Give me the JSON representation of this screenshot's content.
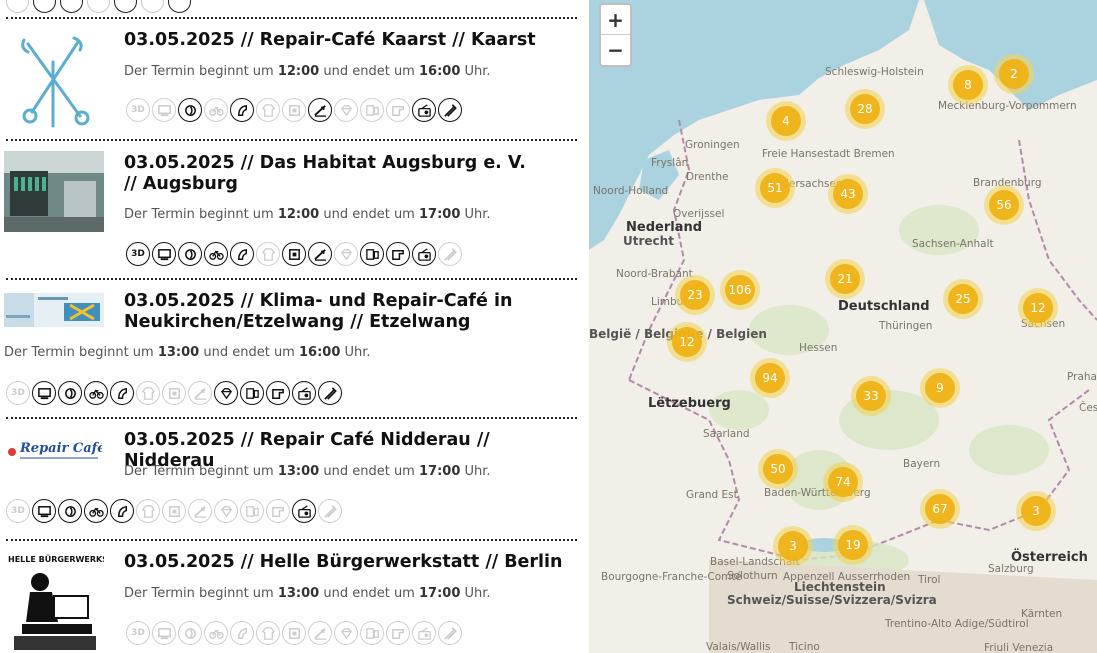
{
  "events": [
    {
      "title": "03.05.2025 // Repair-Café Kaarst // Kaarst",
      "time_prefix": "Der Termin beginnt um ",
      "start": "12:00",
      "time_mid": " und endet um ",
      "end": "16:00",
      "time_suffix": " Uhr.",
      "categories": [
        "3d-printing",
        "computer",
        "vacuum",
        "bicycle",
        "electric",
        "textile",
        "furniture",
        "soldering",
        "jewelry",
        "mobile",
        "sewing",
        "radio",
        "repair-tools"
      ],
      "active": [
        false,
        false,
        true,
        false,
        true,
        false,
        false,
        true,
        false,
        false,
        false,
        true,
        true
      ]
    },
    {
      "title": "03.05.2025 // Das Habitat Augsburg e. V. // Augsburg",
      "time_prefix": "Der Termin beginnt um ",
      "start": "12:00",
      "time_mid": " und endet um ",
      "end": "17:00",
      "time_suffix": " Uhr.",
      "categories": [
        "3d-printing",
        "computer",
        "vacuum",
        "bicycle",
        "electric",
        "textile",
        "furniture",
        "soldering",
        "jewelry",
        "mobile",
        "sewing",
        "radio",
        "repair-tools"
      ],
      "active": [
        true,
        true,
        true,
        true,
        true,
        false,
        true,
        true,
        false,
        true,
        true,
        true,
        false
      ]
    },
    {
      "title": "03.05.2025 // Klima- und Repair-Café in Neukirchen/Etzelwang // Etzelwang",
      "time_prefix": "Der Termin beginnt um ",
      "start": "13:00",
      "time_mid": " und endet um ",
      "end": "16:00",
      "time_suffix": " Uhr.",
      "categories": [
        "3d-printing",
        "computer",
        "vacuum",
        "bicycle",
        "electric",
        "textile",
        "furniture",
        "soldering",
        "jewelry",
        "mobile",
        "sewing",
        "radio",
        "repair-tools"
      ],
      "active": [
        false,
        true,
        true,
        true,
        true,
        false,
        false,
        false,
        true,
        true,
        true,
        true,
        true
      ]
    },
    {
      "title": "03.05.2025 // Repair Café Nidderau // Nidderau",
      "time_prefix": "Der Termin beginnt um ",
      "start": "13:00",
      "time_mid": " und endet um ",
      "end": "17:00",
      "time_suffix": " Uhr.",
      "logo_text": "Repair Café",
      "categories": [
        "3d-printing",
        "computer",
        "vacuum",
        "bicycle",
        "electric",
        "textile",
        "furniture",
        "soldering",
        "jewelry",
        "mobile",
        "sewing",
        "radio",
        "repair-tools"
      ],
      "active": [
        false,
        true,
        true,
        true,
        true,
        false,
        false,
        false,
        false,
        false,
        false,
        true,
        false
      ]
    },
    {
      "title": "03.05.2025 // Helle Bürgerwerkstatt // Berlin",
      "time_prefix": "Der Termin beginnt um ",
      "start": "13:00",
      "time_mid": " und endet um ",
      "end": "17:00",
      "time_suffix": " Uhr.",
      "logo_text": "HELLE BÜRGERWERKSTATT",
      "categories": [
        "3d-printing",
        "computer",
        "vacuum",
        "bicycle",
        "electric",
        "textile",
        "furniture",
        "soldering",
        "jewelry",
        "mobile",
        "sewing",
        "radio",
        "repair-tools"
      ],
      "active": [
        false,
        false,
        false,
        false,
        false,
        false,
        false,
        false,
        false,
        false,
        false,
        false,
        false
      ]
    }
  ],
  "map": {
    "zoom_in": "+",
    "zoom_out": "−",
    "clusters": [
      "2",
      "8",
      "28",
      "4",
      "51",
      "43",
      "56",
      "106",
      "23",
      "21",
      "25",
      "12",
      "12",
      "94",
      "33",
      "9",
      "50",
      "74",
      "67",
      "3",
      "3",
      "19"
    ],
    "labels": [
      "Schleswig-Holstein",
      "Mecklenburg-Vorpommern",
      "Freie Hansestadt Bremen",
      "Groningen",
      "Fryslân",
      "Drenthe",
      "Noord-Holland",
      "Nederland",
      "Utrecht",
      "Overijssel",
      "Niedersachsen",
      "Brandenburg",
      "Noord-Brabant",
      "Limburg",
      "Deutschland",
      "Sachsen-Anhalt",
      "Sachsen",
      "Thüringen",
      "Hessen",
      "België / Belgique / Belgien",
      "Lëtzebuerg",
      "Saarland",
      "Bayern",
      "Baden-Württemberg",
      "Grand Est",
      "Bourgogne-Franche-Comté",
      "Basel-Landschaft",
      "Solothurn",
      "Appenzell Ausserrhoden",
      "Liechtenstein",
      "Schweiz/Suisse/Svizzera/Svizra",
      "Österreich",
      "Praha",
      "Česko",
      "Tirol",
      "Salzburg",
      "Kärnten",
      "Trentino-Alto Adige/Südtirol",
      "Valais/Wallis",
      "Ticino",
      "Friuli Venezia"
    ]
  }
}
